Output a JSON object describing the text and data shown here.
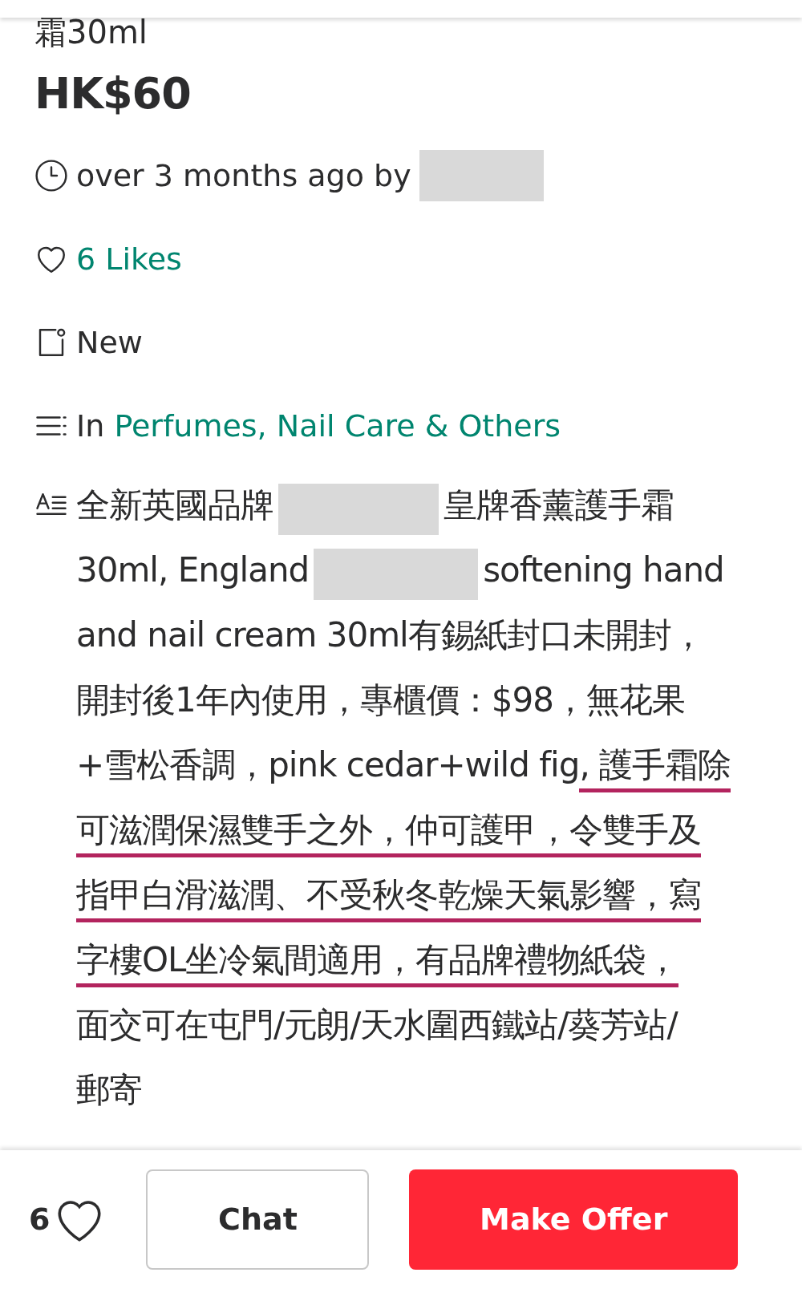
{
  "title": "霜30ml",
  "price": "HK$60",
  "posted": {
    "text": "over 3 months ago by",
    "seller_redacted": true
  },
  "likes": {
    "text": "6 Likes",
    "liked": false
  },
  "condition": "New",
  "category": {
    "prefix": "In",
    "link": "Perfumes, Nail Care & Others"
  },
  "description": [
    [
      {
        "kind": "text",
        "text": "全新英國品牌",
        "underlined": false
      },
      {
        "kind": "redacted"
      },
      {
        "kind": "text",
        "text": "皇牌香薰護手霜",
        "underlined": false
      }
    ],
    [
      {
        "kind": "text",
        "text": "30ml, England",
        "underlined": false
      },
      {
        "kind": "redacted"
      },
      {
        "kind": "text",
        "text": "softening hand",
        "underlined": false
      }
    ],
    [
      {
        "kind": "text",
        "text": "and nail cream 30ml有錫紙封口未開封，",
        "underlined": false
      }
    ],
    [
      {
        "kind": "text",
        "text": "開封後1年內使用，專櫃價：$98，無花果",
        "underlined": false
      }
    ],
    [
      {
        "kind": "text",
        "text": "+雪松香調，pink cedar+wild fig",
        "underlined": false
      },
      {
        "kind": "text",
        "text": ", 護手霜除",
        "underlined": true
      }
    ],
    [
      {
        "kind": "text",
        "text": "可滋潤保濕雙手之外，仲可護甲，令雙手及",
        "underlined": true
      }
    ],
    [
      {
        "kind": "text",
        "text": "指甲白滑滋潤、不受秋冬乾燥天氣影響，寫",
        "underlined": true
      }
    ],
    [
      {
        "kind": "text",
        "text": "字樓OL坐冷氣間適用，有品牌禮物紙袋，",
        "underlined": true
      }
    ],
    [
      {
        "kind": "text",
        "text": "面交可在屯門/元朗/天水圍西鐵站/葵芳站/",
        "underlined": false
      }
    ],
    [
      {
        "kind": "text",
        "text": "郵寄",
        "underlined": false
      }
    ]
  ],
  "bottom_bar": {
    "like_count": "6",
    "liked": false,
    "chat": "Chat",
    "offer": "Make Offer"
  }
}
